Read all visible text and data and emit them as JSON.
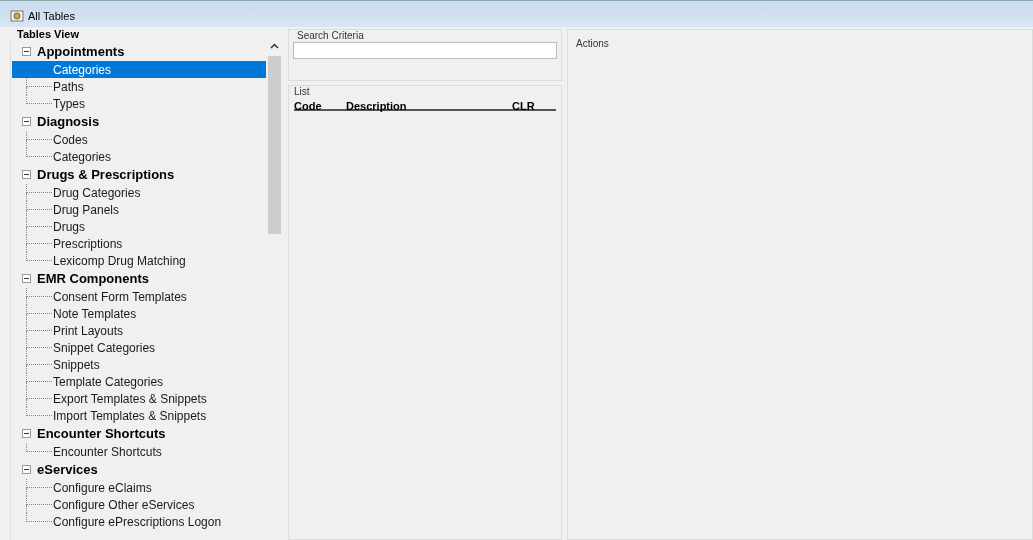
{
  "window": {
    "title": "All Tables"
  },
  "tree": {
    "title": "Tables View",
    "groups": [
      {
        "label": "Appointments",
        "expanded": true,
        "children": [
          {
            "label": "Categories",
            "selected": true
          },
          {
            "label": "Paths",
            "selected": false
          },
          {
            "label": "Types",
            "selected": false
          }
        ]
      },
      {
        "label": "Diagnosis",
        "expanded": true,
        "children": [
          {
            "label": "Codes",
            "selected": false
          },
          {
            "label": "Categories",
            "selected": false
          }
        ]
      },
      {
        "label": "Drugs & Prescriptions",
        "expanded": true,
        "children": [
          {
            "label": "Drug Categories",
            "selected": false
          },
          {
            "label": "Drug Panels",
            "selected": false
          },
          {
            "label": "Drugs",
            "selected": false
          },
          {
            "label": "Prescriptions",
            "selected": false
          },
          {
            "label": "Lexicomp Drug Matching",
            "selected": false
          }
        ]
      },
      {
        "label": "EMR Components",
        "expanded": true,
        "children": [
          {
            "label": "Consent Form Templates",
            "selected": false
          },
          {
            "label": "Note Templates",
            "selected": false
          },
          {
            "label": "Print Layouts",
            "selected": false
          },
          {
            "label": "Snippet Categories",
            "selected": false
          },
          {
            "label": "Snippets",
            "selected": false
          },
          {
            "label": "Template Categories",
            "selected": false
          },
          {
            "label": "Export Templates & Snippets",
            "selected": false
          },
          {
            "label": "Import Templates & Snippets",
            "selected": false
          }
        ]
      },
      {
        "label": "Encounter Shortcuts",
        "expanded": true,
        "children": [
          {
            "label": "Encounter Shortcuts",
            "selected": false
          }
        ]
      },
      {
        "label": "eServices",
        "expanded": true,
        "children": [
          {
            "label": "Configure eClaims",
            "selected": false
          },
          {
            "label": "Configure Other eServices",
            "selected": false
          },
          {
            "label": "Configure ePrescriptions Logon",
            "selected": false
          }
        ]
      }
    ]
  },
  "search": {
    "title": "Search Criteria"
  },
  "list": {
    "title": "List",
    "columns": [
      "Code",
      "Description",
      "CLR"
    ]
  },
  "actions": {
    "title": "Actions"
  }
}
